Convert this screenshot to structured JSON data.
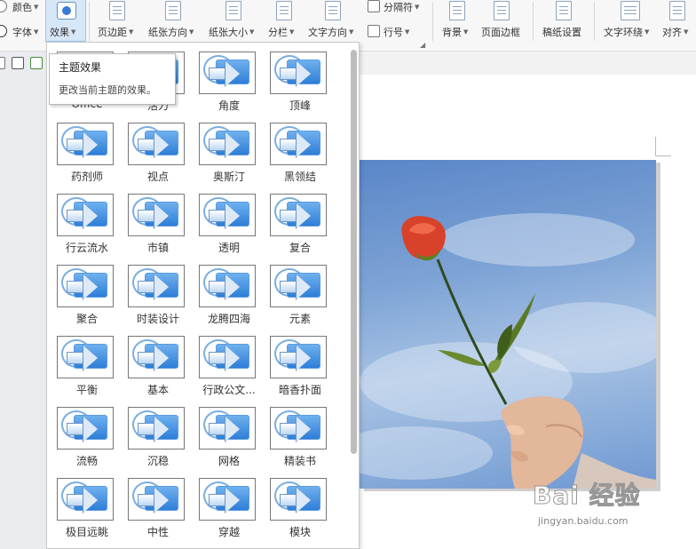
{
  "ribbon": {
    "color_label": "颜色",
    "font_label": "字体",
    "effect_label": "效果",
    "margins_label": "页边距",
    "orientation_label": "纸张方向",
    "size_label": "纸张大小",
    "columns_label": "分栏",
    "text_direction_label": "文字方向",
    "separator_label": "分隔符",
    "line_number_label": "行号",
    "background_label": "背景",
    "page_border_label": "页面边框",
    "draft_paper_label": "稿纸设置",
    "text_wrap_label": "文字环绕",
    "align_label": "对齐"
  },
  "tooltip": {
    "title": "主题效果",
    "description": "更改当前主题的效果。"
  },
  "gallery": {
    "items": [
      {
        "label": "Office"
      },
      {
        "label": "活力"
      },
      {
        "label": "角度"
      },
      {
        "label": "顶峰"
      },
      {
        "label": "药剂师"
      },
      {
        "label": "视点"
      },
      {
        "label": "奥斯汀"
      },
      {
        "label": "黑领结"
      },
      {
        "label": "行云流水"
      },
      {
        "label": "市镇"
      },
      {
        "label": "透明"
      },
      {
        "label": "复合"
      },
      {
        "label": "聚合"
      },
      {
        "label": "时装设计"
      },
      {
        "label": "龙腾四海"
      },
      {
        "label": "元素"
      },
      {
        "label": "平衡"
      },
      {
        "label": "基本"
      },
      {
        "label": "行政公文..."
      },
      {
        "label": "暗香扑面"
      },
      {
        "label": "流畅"
      },
      {
        "label": "沉稳"
      },
      {
        "label": "网格"
      },
      {
        "label": "精装书"
      },
      {
        "label": "极目远眺"
      },
      {
        "label": "中性"
      },
      {
        "label": "穿越"
      },
      {
        "label": "模块"
      }
    ]
  },
  "watermark": {
    "brand": "Bai 经验",
    "url": "jingyan.baidu.com"
  },
  "colors": {
    "accent_blue": "#3a7bd5",
    "selected_button": "#d6e8f8",
    "sky": "#7ea4d6",
    "rose": "#d8412a"
  }
}
